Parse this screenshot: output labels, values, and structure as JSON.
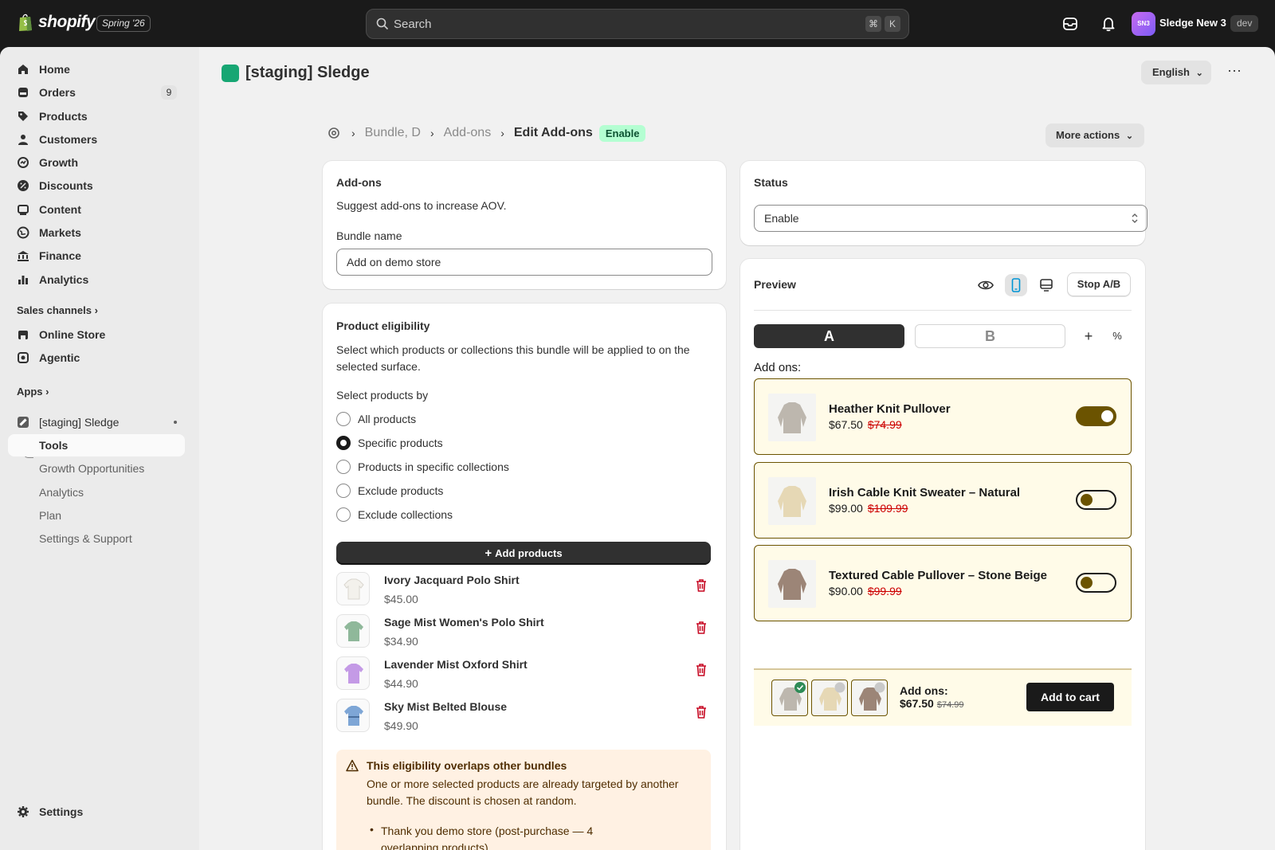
{
  "topbar": {
    "brand": "shopify",
    "version": "Spring '26",
    "search_placeholder": "Search",
    "kbd_cmd": "⌘",
    "kbd_k": "K",
    "store_initials": "SN3",
    "store_name": "Sledge New 3",
    "env_badge": "dev"
  },
  "sidebar": {
    "items": [
      {
        "label": "Home",
        "icon": "home-icon"
      },
      {
        "label": "Orders",
        "icon": "orders-icon",
        "badge": "9"
      },
      {
        "label": "Products",
        "icon": "tag-icon"
      },
      {
        "label": "Customers",
        "icon": "person-icon"
      },
      {
        "label": "Growth",
        "icon": "growth-icon"
      },
      {
        "label": "Discounts",
        "icon": "discount-icon"
      },
      {
        "label": "Content",
        "icon": "content-icon"
      },
      {
        "label": "Markets",
        "icon": "globe-icon"
      },
      {
        "label": "Finance",
        "icon": "bank-icon"
      },
      {
        "label": "Analytics",
        "icon": "chart-icon"
      }
    ],
    "sales_channels_label": "Sales channels",
    "channels": [
      {
        "label": "Online Store",
        "icon": "store-icon"
      },
      {
        "label": "Agentic",
        "icon": "agentic-icon"
      }
    ],
    "apps_label": "Apps",
    "app_name": "[staging] Sledge",
    "app_sub_items": [
      "Tools",
      "Growth Opportunities",
      "Analytics",
      "Plan",
      "Settings & Support"
    ],
    "settings_label": "Settings"
  },
  "header": {
    "app_title": "[staging] Sledge",
    "language": "English"
  },
  "breadcrumb": {
    "crumb1": "Bundle, D",
    "crumb2": "Add-ons",
    "current": "Edit Add-ons",
    "status_badge": "Enable"
  },
  "more_actions_label": "More actions",
  "addons_card": {
    "title": "Add-ons",
    "description": "Suggest add-ons to increase AOV.",
    "bundle_name_label": "Bundle name",
    "bundle_name_value": "Add on demo store"
  },
  "eligibility_card": {
    "title": "Product eligibility",
    "description": "Select which products or collections this bundle will be applied to on the selected surface.",
    "select_by_label": "Select products by",
    "options": [
      "All products",
      "Specific products",
      "Products in specific collections",
      "Exclude products",
      "Exclude collections"
    ],
    "selected_index": 1,
    "add_products_label": "Add products",
    "products": [
      {
        "name": "Ivory Jacquard Polo Shirt",
        "price": "$45.00",
        "color": "#f3f1ec"
      },
      {
        "name": "Sage Mist Women's Polo Shirt",
        "price": "$34.90",
        "color": "#8fb89a"
      },
      {
        "name": "Lavender Mist Oxford Shirt",
        "price": "$44.90",
        "color": "#c49ae6"
      },
      {
        "name": "Sky Mist Belted Blouse",
        "price": "$49.90",
        "color": "#7ea6d6"
      }
    ],
    "warning": {
      "title": "This eligibility overlaps other bundles",
      "body": "One or more selected products are already targeted by another bundle. The discount is chosen at random.",
      "bullet_link": "Thank you demo store",
      "bullet_rest": " (post-purchase — 4 overlapping products)"
    }
  },
  "status_card": {
    "title": "Status",
    "value": "Enable"
  },
  "preview_card": {
    "title": "Preview",
    "stop_ab_label": "Stop A/B",
    "variant_a": "A",
    "variant_b": "B",
    "addons_heading": "Add ons:",
    "items": [
      {
        "name": "Heather Knit Pullover",
        "price": "$67.50",
        "old_price": "$74.99",
        "enabled": true,
        "color": "#bdb7ae"
      },
      {
        "name": "Irish Cable Knit Sweater – Natural",
        "price": "$99.00",
        "old_price": "$109.99",
        "enabled": false,
        "color": "#e6d8b5"
      },
      {
        "name": "Textured Cable Pullover – Stone Beige",
        "price": "$90.00",
        "old_price": "$99.99",
        "enabled": false,
        "color": "#9c8577"
      }
    ],
    "bar_label": "Add ons:",
    "bar_price": "$67.50",
    "bar_old_price": "$74.99",
    "add_to_cart_label": "Add to cart"
  },
  "colors": {
    "accent_dark": "#303030",
    "addon_border": "#6b5300",
    "addon_bg": "#fffbe8",
    "enable_badge_bg": "#b4fed2",
    "warning_bg": "#fff1e3"
  }
}
